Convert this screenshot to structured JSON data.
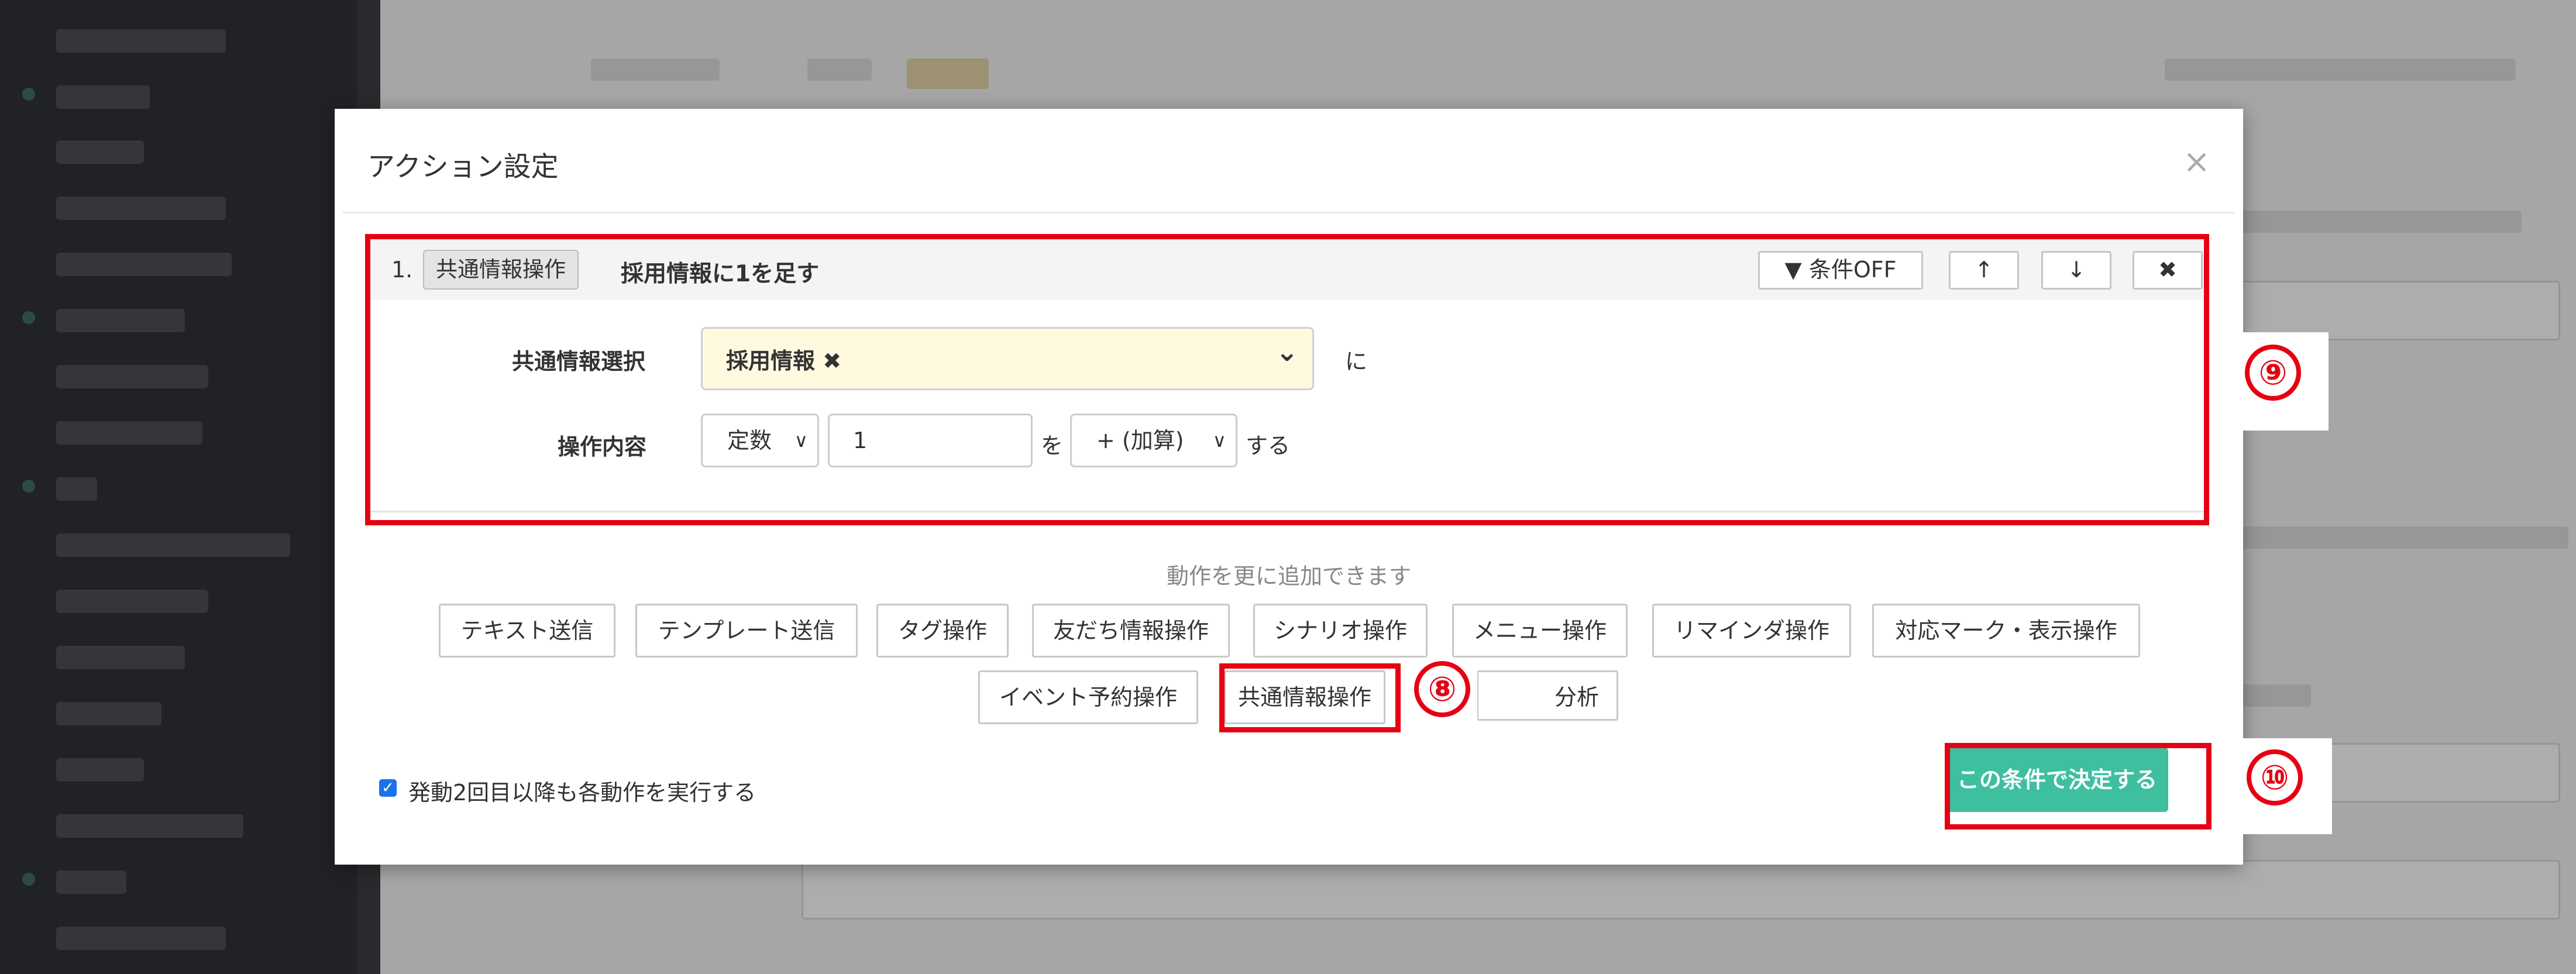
{
  "modal": {
    "title": "アクション設定",
    "close_symbol": "×"
  },
  "action": {
    "number": "1.",
    "type_badge": "共通情報操作",
    "title": "採用情報に1を足す",
    "buttons": {
      "condition_off": "▼ 条件OFF",
      "up": "↑",
      "down": "↓",
      "delete": "✖"
    },
    "fields": {
      "select_label": "共通情報選択",
      "select_value": "採用情報 ✖",
      "select_after": "に",
      "operation_label": "操作内容",
      "operation_type": "定数",
      "operation_value": "1",
      "operation_wo": "を",
      "operation_op": "+ (加算)",
      "operation_suru": "する"
    }
  },
  "add_actions": {
    "hint": "動作を更に追加できます",
    "row1": [
      "テキスト送信",
      "テンプレート送信",
      "タグ操作",
      "友だち情報操作",
      "シナリオ操作",
      "メニュー操作",
      "リマインダ操作",
      "対応マーク・表示操作"
    ],
    "row2": [
      "イベント予約操作",
      "共通情報操作",
      "分析"
    ]
  },
  "footer": {
    "checkbox_label": "発動2回目以降も各動作を実行する",
    "checkbox_checked": true,
    "submit_label": "この条件で決定する"
  },
  "annotations": {
    "eight": "⑧",
    "nine": "⑨",
    "ten": "⑩"
  },
  "colors": {
    "highlight": "#e60012",
    "submit": "#3dbfa0",
    "select_bg": "#fff9e0"
  },
  "icons": {
    "filter": "filter-icon",
    "up": "arrow-up-icon",
    "down": "arrow-down-icon",
    "delete": "delete-icon",
    "chevron": "chevron-down-icon",
    "check": "check-icon"
  }
}
